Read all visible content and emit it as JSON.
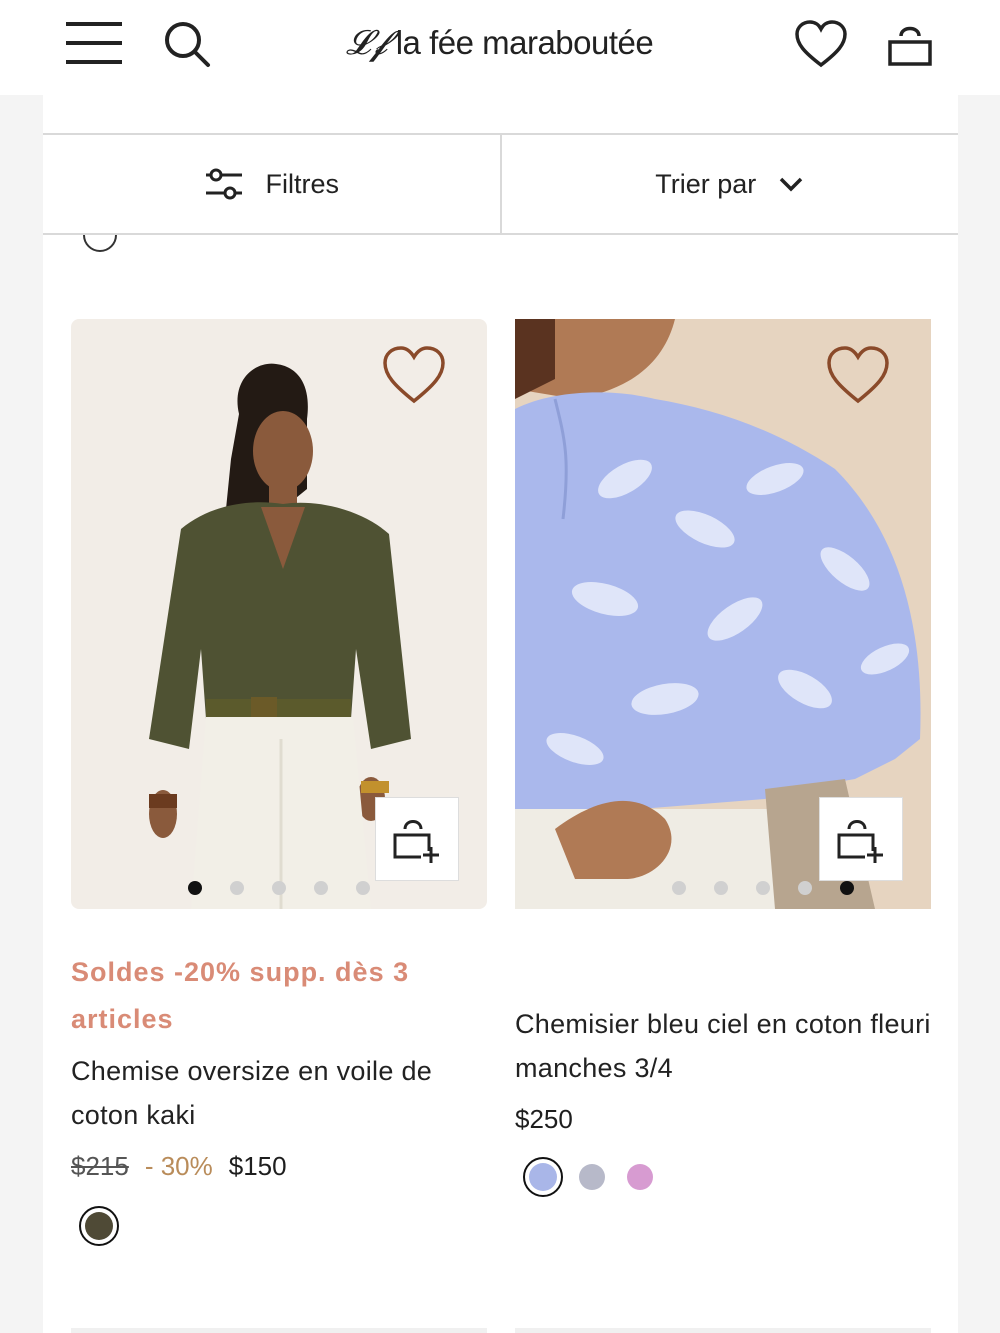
{
  "header": {
    "logo_mark": "𝓛𝓯",
    "logo_text": "la fée maraboutée",
    "icons": [
      "menu-icon",
      "search-icon",
      "heart-icon",
      "bag-icon"
    ]
  },
  "toolbar": {
    "filters_label": "Filtres",
    "sort_label": "Trier par"
  },
  "products": [
    {
      "promo": "Soldes -20% supp. dès 3 articles",
      "name": "Chemise oversize en voile de coton kaki",
      "old_price": "$215",
      "discount": "- 30%",
      "price": "$150",
      "active_image": 0,
      "image_count": 5,
      "swatches": [
        {
          "color": "#4f4a36",
          "selected": true
        }
      ]
    },
    {
      "promo": "",
      "name": "Chemisier bleu ciel en coton fleuri manches 3/4",
      "old_price": "",
      "discount": "",
      "price": "$250",
      "active_image": 4,
      "image_count": 5,
      "swatches": [
        {
          "color": "#a9b6e8",
          "selected": true
        },
        {
          "color": "#b7b9c9",
          "selected": false
        },
        {
          "color": "#d79bd1",
          "selected": false
        }
      ]
    }
  ],
  "colors": {
    "promo": "#d98b76",
    "discount": "#b98c5a",
    "heart": "#8a4a2a"
  }
}
